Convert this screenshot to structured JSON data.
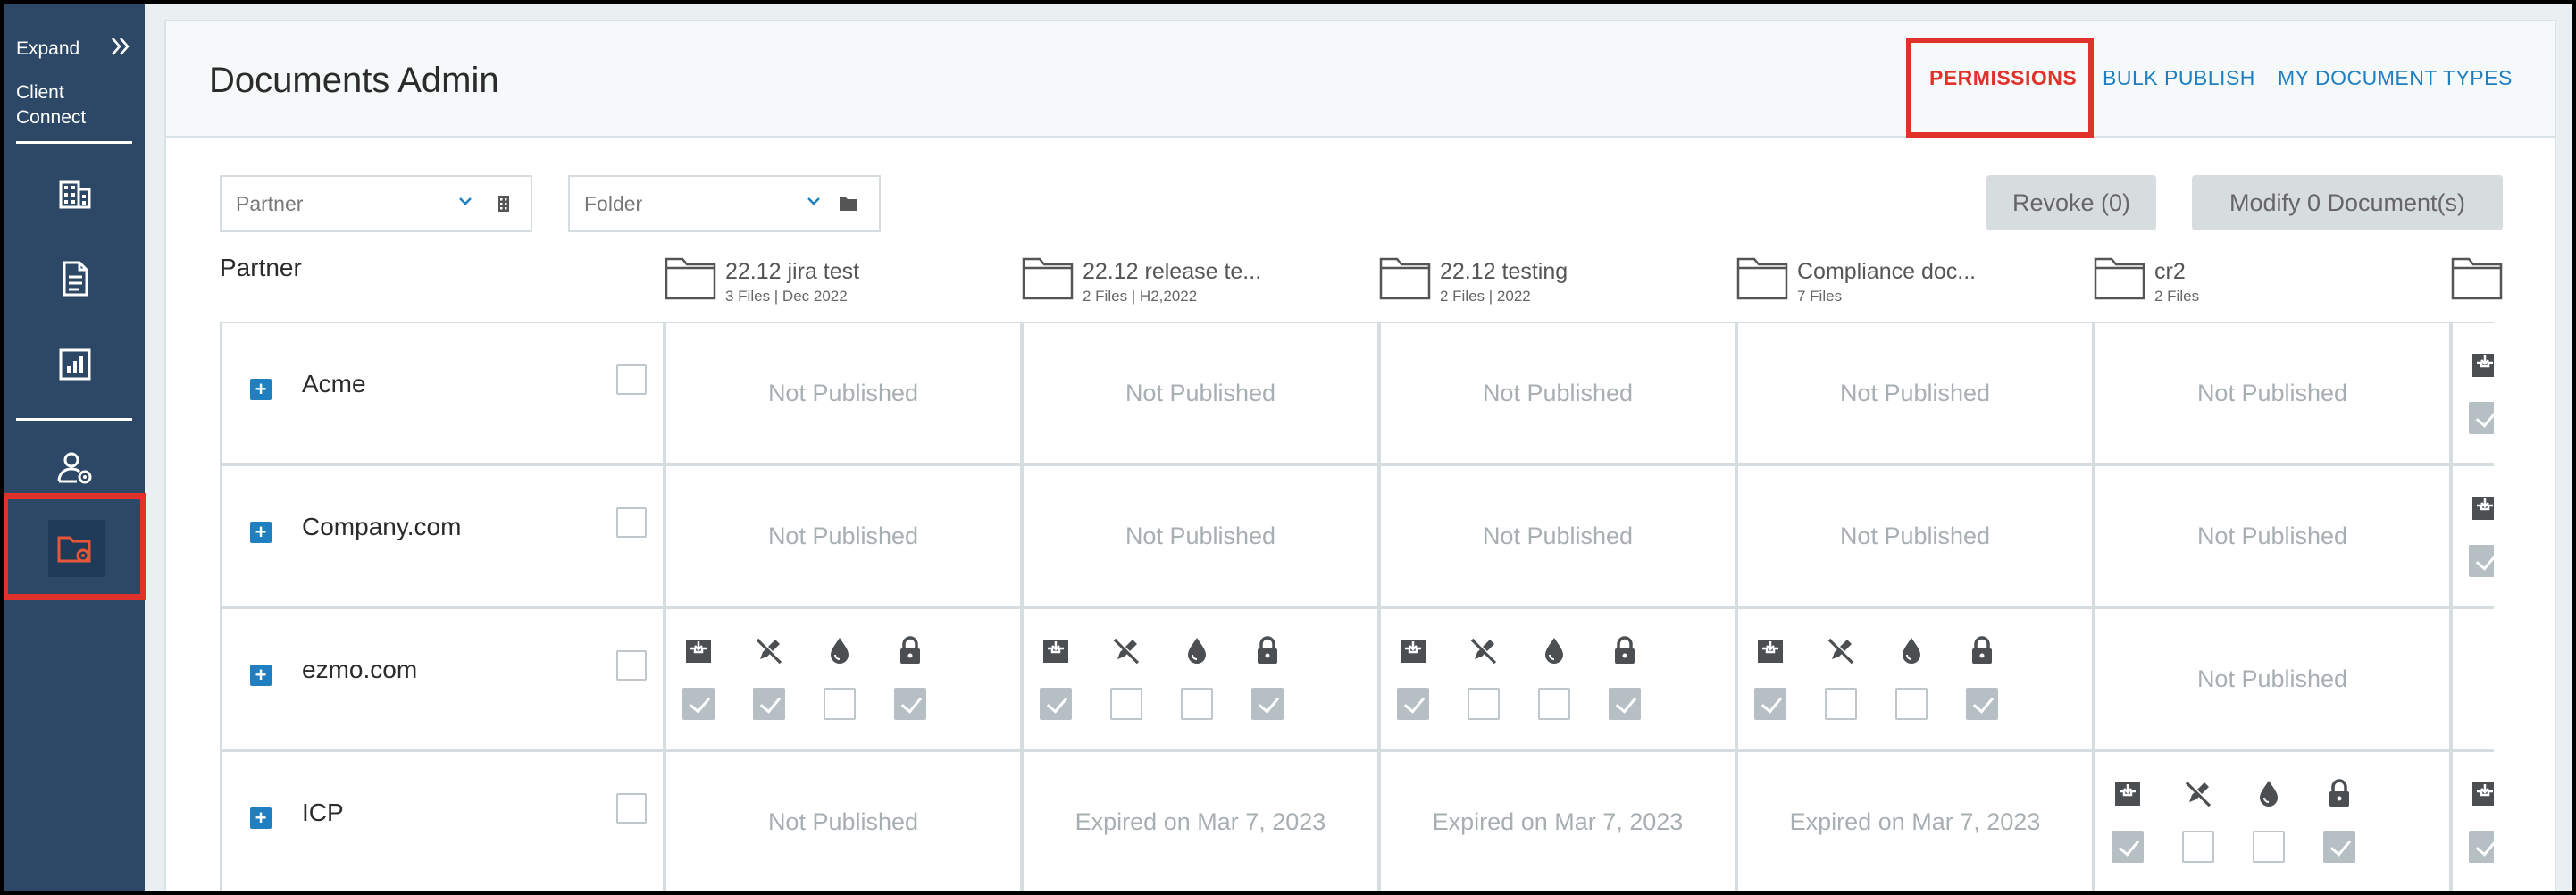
{
  "sidebar": {
    "expand_label": "Expand",
    "brand": [
      "Client",
      "Connect"
    ],
    "items": [
      {
        "name": "building-icon"
      },
      {
        "name": "document-icon"
      },
      {
        "name": "report-chart-icon"
      },
      {
        "name": "user-settings-icon"
      },
      {
        "name": "folder-settings-icon",
        "active": true
      }
    ]
  },
  "header": {
    "title": "Documents Admin",
    "links": [
      {
        "label": "PERMISSIONS",
        "active": true
      },
      {
        "label": "BULK PUBLISH",
        "active": false
      },
      {
        "label": "MY DOCUMENT TYPES",
        "active": false
      }
    ]
  },
  "filters": {
    "partner_placeholder": "Partner",
    "folder_placeholder": "Folder"
  },
  "actions": {
    "revoke_label": "Revoke (0)",
    "modify_label": "Modify 0 Document(s)"
  },
  "grid": {
    "partner_heading": "Partner",
    "columns": [
      {
        "name": "22.12 jira test",
        "meta": "3 Files | Dec 2022"
      },
      {
        "name": "22.12 release te...",
        "meta": "2 Files | H2,2022"
      },
      {
        "name": "22.12 testing",
        "meta": "2 Files | 2022"
      },
      {
        "name": "Compliance doc...",
        "meta": "7 Files"
      },
      {
        "name": "cr2",
        "meta": "2 Files"
      },
      {
        "name": "",
        "meta": ""
      }
    ],
    "perm_icon_names": [
      "download-tray-icon",
      "no-edit-pencil-icon",
      "watermark-drop-icon",
      "lock-icon"
    ],
    "rows": [
      {
        "partner": "Acme",
        "cells": [
          {
            "status": "Not Published"
          },
          {
            "status": "Not Published"
          },
          {
            "status": "Not Published"
          },
          {
            "status": "Not Published"
          },
          {
            "status": "Not Published"
          },
          {
            "perms": [
              true,
              true,
              false,
              true
            ]
          }
        ]
      },
      {
        "partner": "Company.com",
        "cells": [
          {
            "status": "Not Published"
          },
          {
            "status": "Not Published"
          },
          {
            "status": "Not Published"
          },
          {
            "status": "Not Published"
          },
          {
            "status": "Not Published"
          },
          {
            "perms": [
              true,
              true,
              false,
              true
            ]
          }
        ]
      },
      {
        "partner": "ezmo.com",
        "cells": [
          {
            "perms": [
              true,
              true,
              false,
              true
            ]
          },
          {
            "perms": [
              true,
              false,
              false,
              true
            ]
          },
          {
            "perms": [
              true,
              false,
              false,
              true
            ]
          },
          {
            "perms": [
              true,
              false,
              false,
              true
            ]
          },
          {
            "status": "Not Published"
          },
          {
            "status": ""
          }
        ]
      },
      {
        "partner": "ICP",
        "cells": [
          {
            "status": "Not Published"
          },
          {
            "status": "Expired on Mar 7, 2023"
          },
          {
            "status": "Expired on Mar 7, 2023"
          },
          {
            "status": "Expired on Mar 7, 2023"
          },
          {
            "perms": [
              true,
              false,
              false,
              true
            ]
          },
          {
            "perms": [
              true,
              true,
              false,
              true
            ]
          }
        ]
      }
    ]
  }
}
